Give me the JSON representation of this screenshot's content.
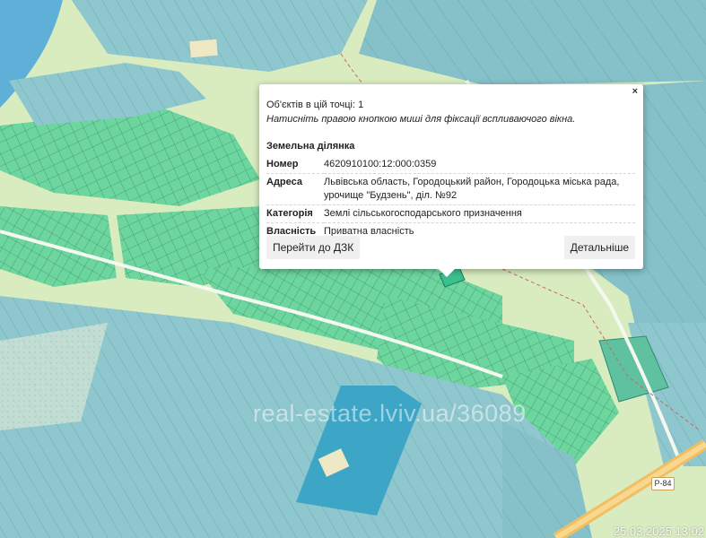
{
  "popup": {
    "close": "×",
    "objects_count": "Об'єктів в цій точці: 1",
    "hint": "Натисніть правою кнопкою миші для фіксації вспливаючого вікна.",
    "section_title": "Земельна ділянка",
    "rows": [
      {
        "key": "Номер",
        "value": "4620910100:12:000:0359"
      },
      {
        "key": "Адреса",
        "value": "Львівська область, Городоцький район, Городоцька міська рада, урочище \"Будзень\", діл. №92"
      },
      {
        "key": "Категорія",
        "value": "Землі сільськогосподарського призначення"
      },
      {
        "key": "Власність",
        "value": "Приватна власність"
      }
    ],
    "btn_dzk": "Перейти до ДЗК",
    "btn_details": "Детальніше"
  },
  "map": {
    "road_label": "Р-84",
    "watermark": "real-estate.lviv.ua/36089",
    "timestamp": "25.03.2025 13:02",
    "colors": {
      "background": "#d9ecc0",
      "parcel_green": "#6fd7a0",
      "field_blue": "#8fc8cf",
      "water": "#5fb0d8",
      "road": "#f3c060"
    }
  }
}
